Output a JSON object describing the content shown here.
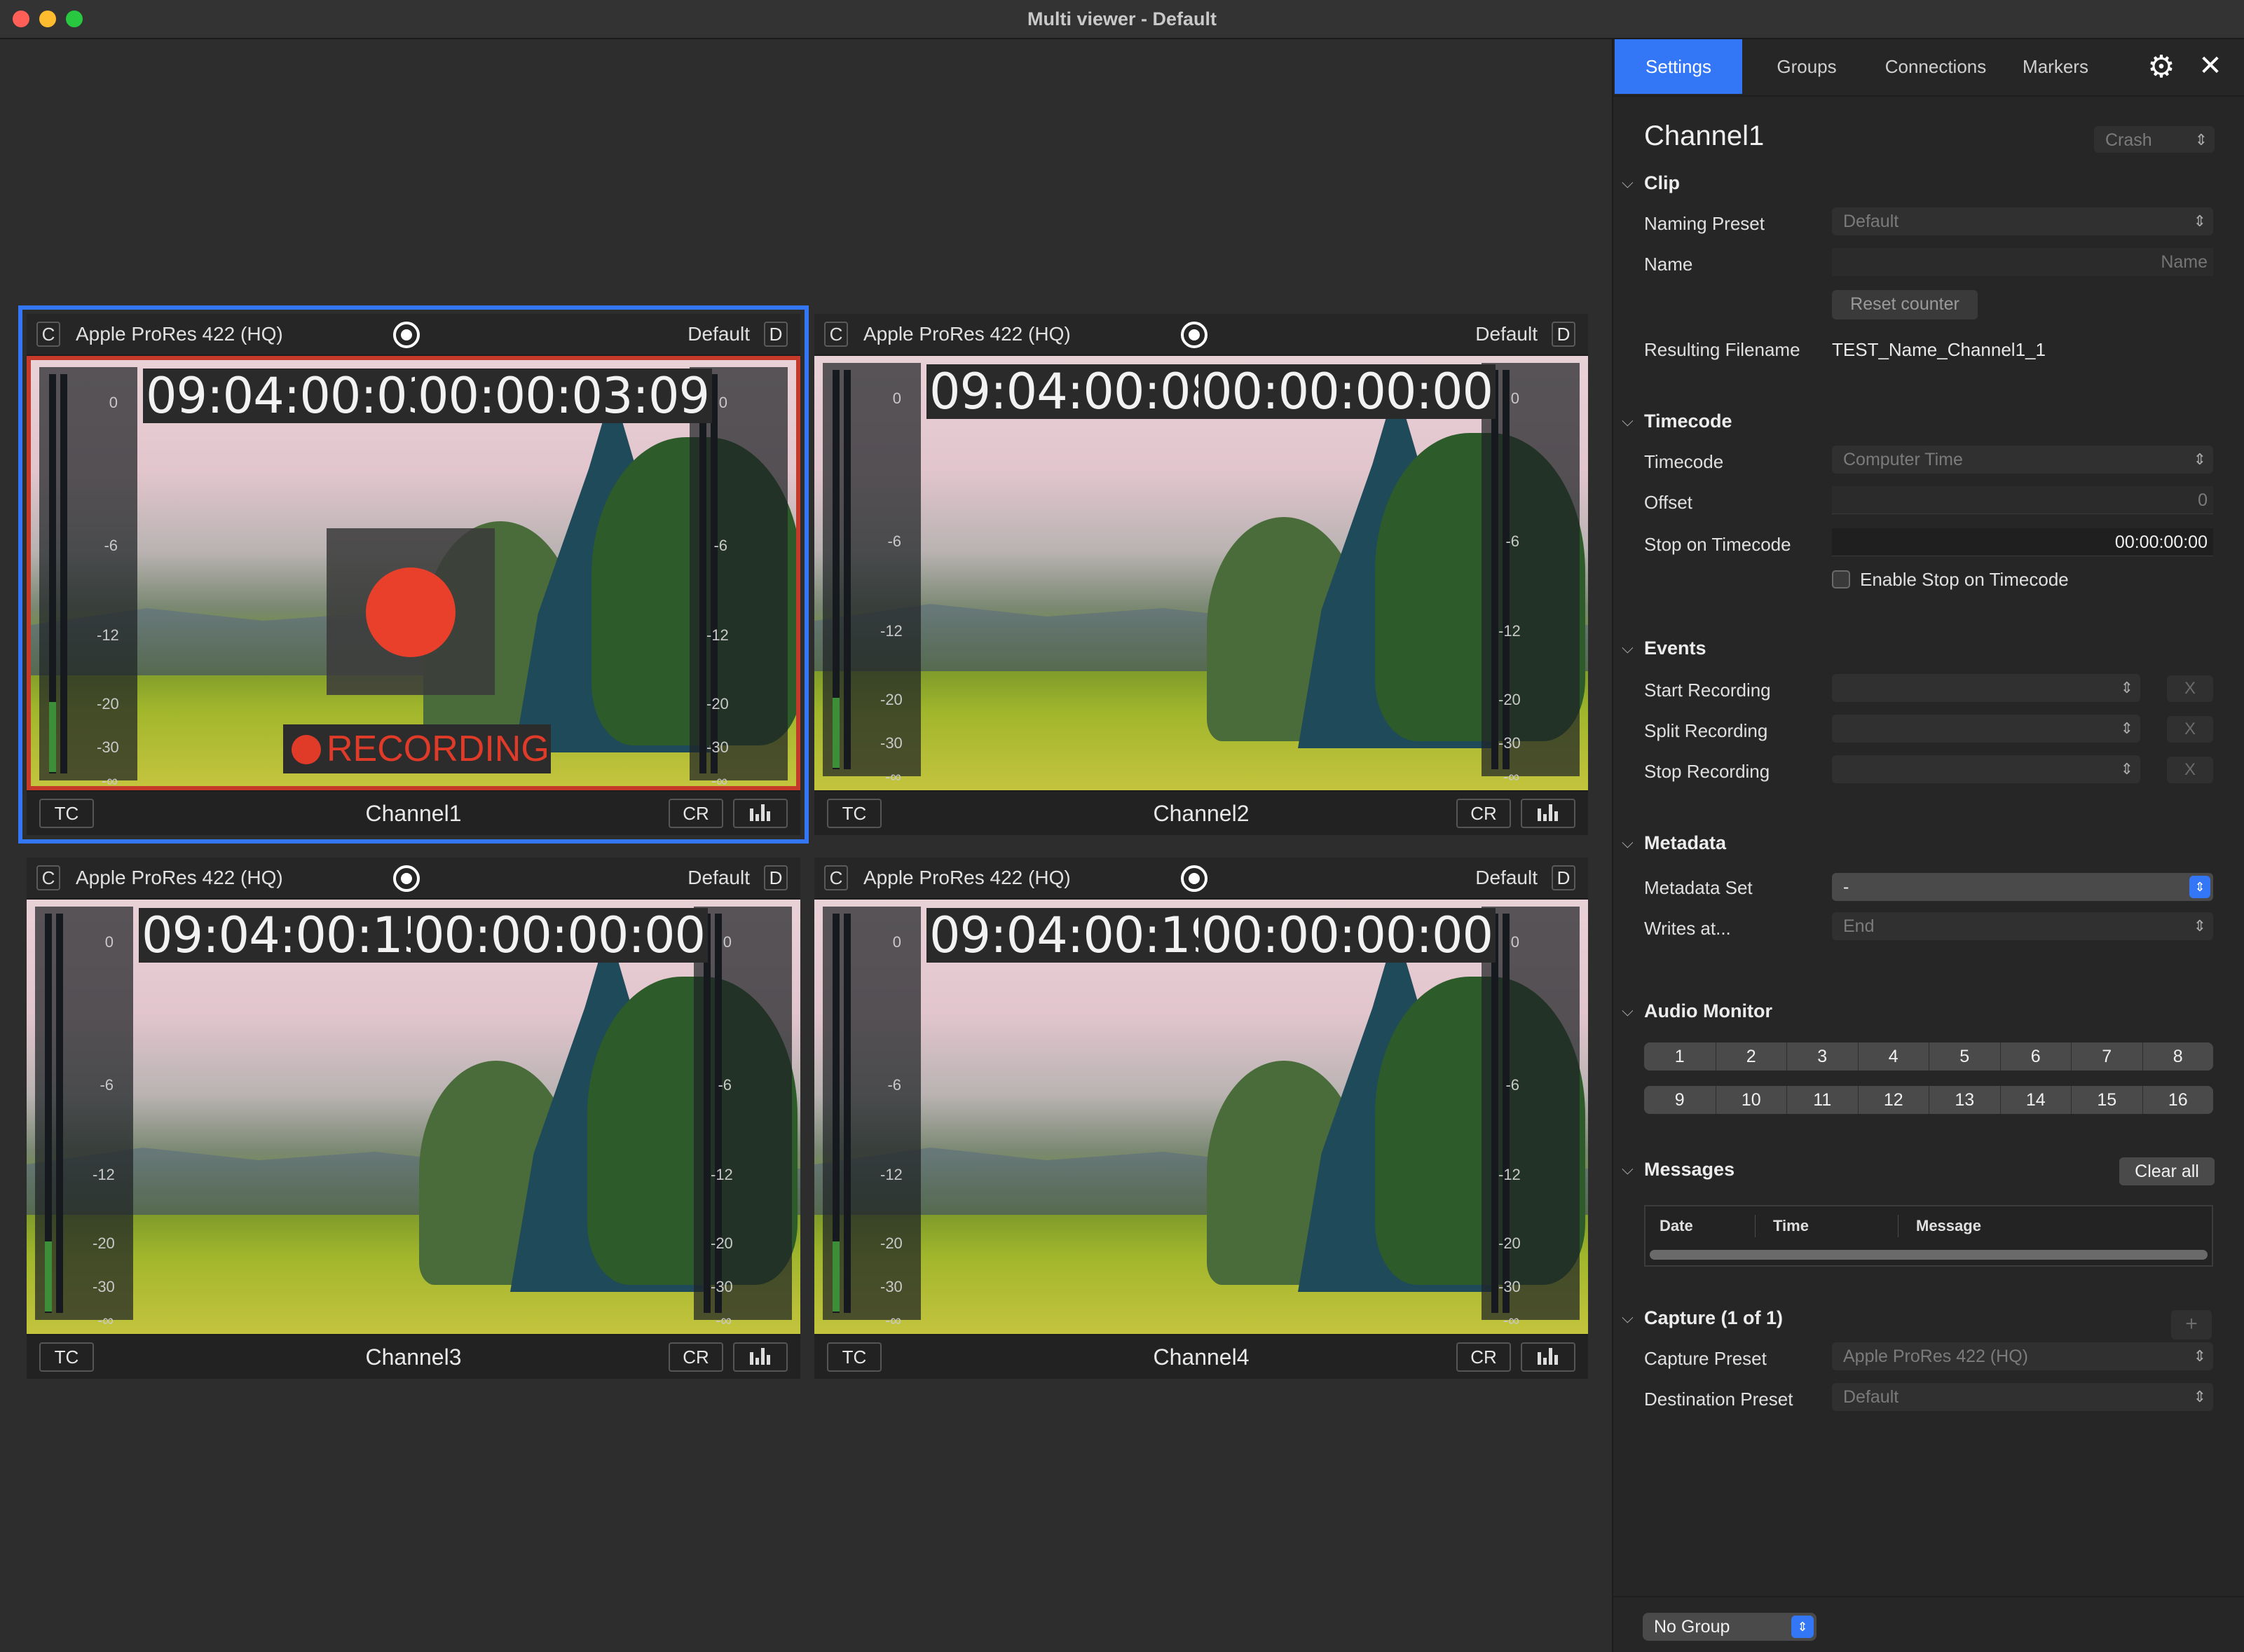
{
  "window": {
    "title": "Multi viewer - Default",
    "traffic_lights": [
      "#ff5f57",
      "#febc2e",
      "#28c840"
    ]
  },
  "viewports": [
    {
      "codec": "Apple ProRes 422 (HQ)",
      "c_label": "C",
      "preset": "Default",
      "d_label": "D",
      "tc_left": "09:04:00:03",
      "tc_right": "00:00:03:09",
      "name": "Channel1",
      "tc_btn": "TC",
      "cr_btn": "CR",
      "recording": true,
      "recording_label": "RECORDING",
      "selected": true
    },
    {
      "codec": "Apple ProRes 422 (HQ)",
      "c_label": "C",
      "preset": "Default",
      "d_label": "D",
      "tc_left": "09:04:00:08",
      "tc_right": "00:00:00:00",
      "name": "Channel2",
      "tc_btn": "TC",
      "cr_btn": "CR",
      "recording": false
    },
    {
      "codec": "Apple ProRes 422 (HQ)",
      "c_label": "C",
      "preset": "Default",
      "d_label": "D",
      "tc_left": "09:04:00:15",
      "tc_right": "00:00:00:00",
      "name": "Channel3",
      "tc_btn": "TC",
      "cr_btn": "CR",
      "recording": false
    },
    {
      "codec": "Apple ProRes 422 (HQ)",
      "c_label": "C",
      "preset": "Default",
      "d_label": "D",
      "tc_left": "09:04:00:19",
      "tc_right": "00:00:00:00",
      "name": "Channel4",
      "tc_btn": "TC",
      "cr_btn": "CR",
      "recording": false
    }
  ],
  "meter_ticks": [
    "0",
    "-6",
    "-12",
    "-20",
    "-30",
    "-∞"
  ],
  "sidebar": {
    "tabs": [
      "Settings",
      "Groups",
      "Connections",
      "Markers"
    ],
    "active_tab": "Settings",
    "channel_title": "Channel1",
    "crash_label": "Crash",
    "clip": {
      "title": "Clip",
      "naming_preset_label": "Naming Preset",
      "naming_preset_value": "Default",
      "name_label": "Name",
      "name_placeholder": "Name",
      "reset_counter": "Reset counter",
      "resulting_filename_label": "Resulting Filename",
      "resulting_filename_value": "TEST_Name_Channel1_1"
    },
    "timecode": {
      "title": "Timecode",
      "timecode_label": "Timecode",
      "timecode_value": "Computer Time",
      "offset_label": "Offset",
      "offset_value": "0",
      "stop_label": "Stop on Timecode",
      "stop_value": "00:00:00:00",
      "enable_stop_label": "Enable Stop on Timecode"
    },
    "events": {
      "title": "Events",
      "start_label": "Start Recording",
      "split_label": "Split Recording",
      "stop_label": "Stop Recording",
      "clear_label": "X"
    },
    "metadata": {
      "title": "Metadata",
      "set_label": "Metadata Set",
      "set_value": "-",
      "writes_label": "Writes at...",
      "writes_value": "End"
    },
    "audio": {
      "title": "Audio Monitor",
      "row1": [
        "1",
        "2",
        "3",
        "4",
        "5",
        "6",
        "7",
        "8"
      ],
      "row2": [
        "9",
        "10",
        "11",
        "12",
        "13",
        "14",
        "15",
        "16"
      ]
    },
    "messages": {
      "title": "Messages",
      "clear_all": "Clear all",
      "columns": [
        "Date",
        "Time",
        "Message"
      ]
    },
    "capture": {
      "title": "Capture (1 of 1)",
      "plus": "+",
      "preset_label": "Capture Preset",
      "preset_value": "Apple ProRes 422 (HQ)",
      "dest_label": "Destination Preset",
      "dest_value": "Default"
    },
    "footer": {
      "group_value": "No Group"
    }
  }
}
